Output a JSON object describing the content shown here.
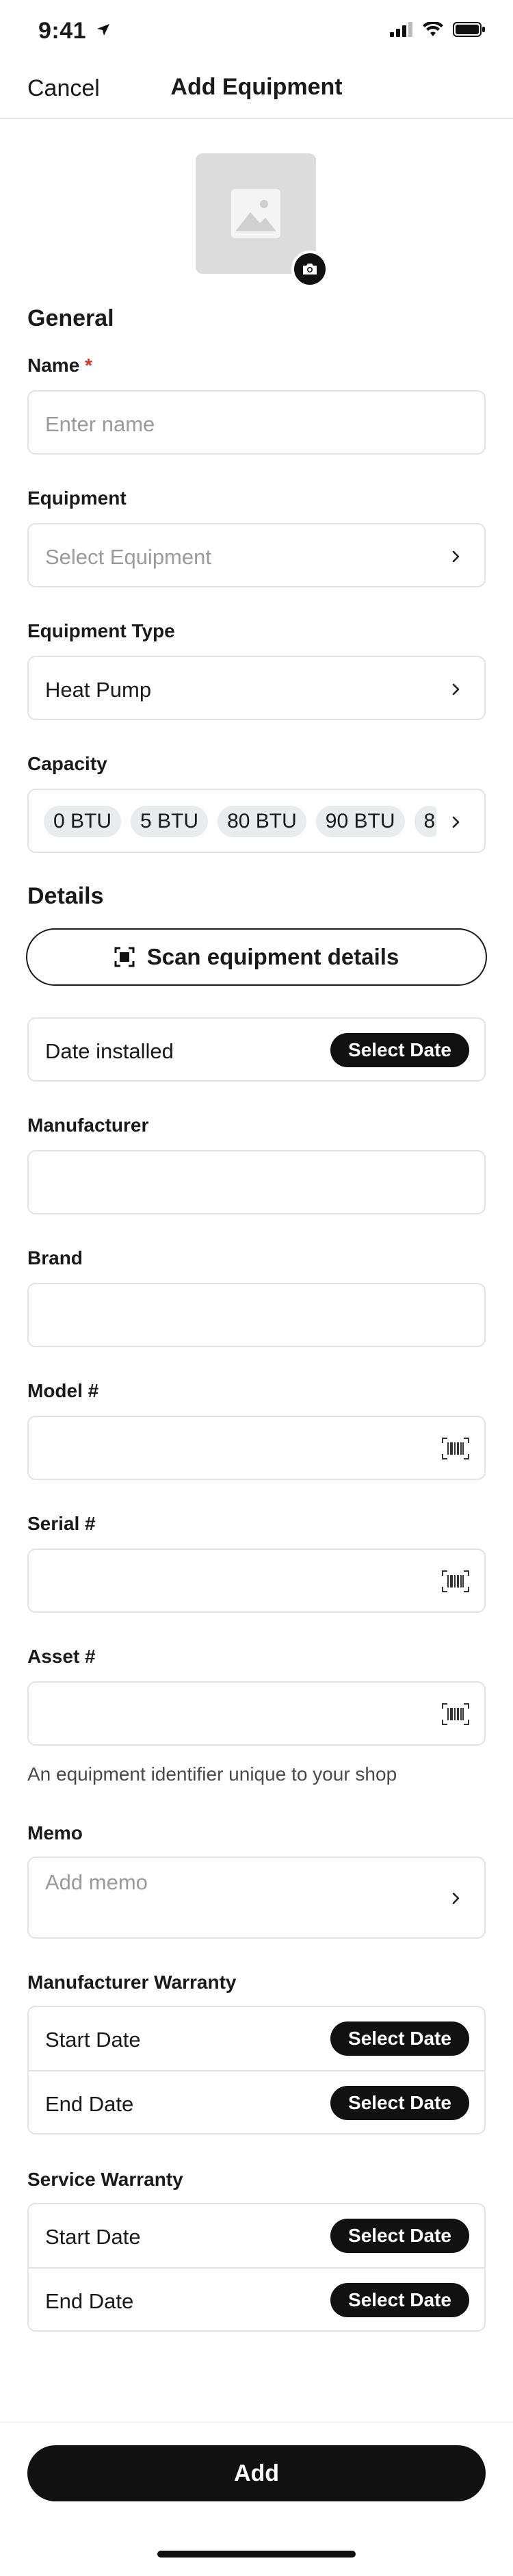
{
  "status_bar": {
    "time": "9:41"
  },
  "nav": {
    "cancel_label": "Cancel",
    "title": "Add Equipment"
  },
  "general": {
    "heading": "General",
    "name": {
      "label": "Name",
      "required_mark": "*",
      "placeholder": "Enter name"
    },
    "equipment": {
      "label": "Equipment",
      "placeholder": "Select Equipment"
    },
    "equipment_type": {
      "label": "Equipment Type",
      "value": "Heat Pump"
    },
    "capacity": {
      "label": "Capacity",
      "options": [
        "0 BTU",
        "5 BTU",
        "80 BTU",
        "90 BTU",
        "8"
      ]
    }
  },
  "details": {
    "heading": "Details",
    "scan_button_label": "Scan equipment details",
    "date_installed": {
      "label": "Date installed",
      "button_label": "Select Date"
    },
    "manufacturer": {
      "label": "Manufacturer",
      "value": ""
    },
    "brand": {
      "label": "Brand",
      "value": ""
    },
    "model": {
      "label": "Model #",
      "value": ""
    },
    "serial": {
      "label": "Serial #",
      "value": ""
    },
    "asset": {
      "label": "Asset #",
      "value": "",
      "hint": "An equipment identifier unique to your shop"
    },
    "memo": {
      "label": "Memo",
      "placeholder": "Add memo"
    }
  },
  "manufacturer_warranty": {
    "heading": "Manufacturer Warranty",
    "start_label": "Start Date",
    "end_label": "End Date",
    "button_label": "Select Date"
  },
  "service_warranty": {
    "heading": "Service Warranty",
    "start_label": "Start Date",
    "end_label": "End Date",
    "button_label": "Select Date"
  },
  "footer": {
    "add_label": "Add"
  },
  "colors": {
    "accent": "#111111",
    "required": "#d4322b",
    "border": "#e3e3e3",
    "chip": "#e8ecec"
  }
}
